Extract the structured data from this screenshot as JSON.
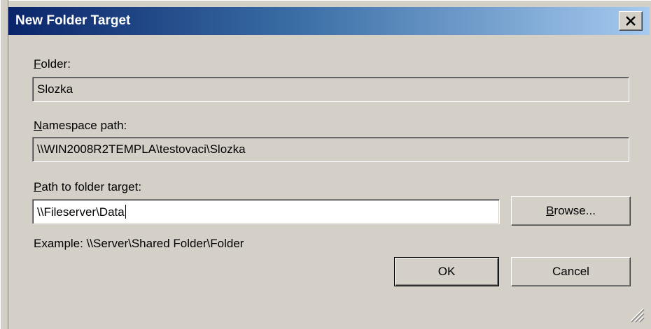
{
  "window": {
    "title": "New Folder Target",
    "close_label": "Close"
  },
  "folder": {
    "label_key": "F",
    "label_rest": "older:",
    "value": "Slozka"
  },
  "namespace_path": {
    "label_key": "N",
    "label_rest": "amespace path:",
    "value": "\\\\WIN2008R2TEMPLA\\testovaci\\Slozka"
  },
  "folder_target": {
    "label_key": "P",
    "label_rest": "ath to folder target:",
    "value": "\\\\Fileserver\\Data",
    "browse_key": "B",
    "browse_rest": "rowse...",
    "example": "Example: \\\\Server\\Shared Folder\\Folder"
  },
  "buttons": {
    "ok": "OK",
    "cancel": "Cancel"
  },
  "colors": {
    "face": "#d4d0c8",
    "titlebar_start": "#0a246a",
    "titlebar_end": "#a6caf0",
    "title_text": "#ffffff"
  },
  "icons": {
    "close": "close-icon",
    "resize": "resize-grip-icon"
  }
}
